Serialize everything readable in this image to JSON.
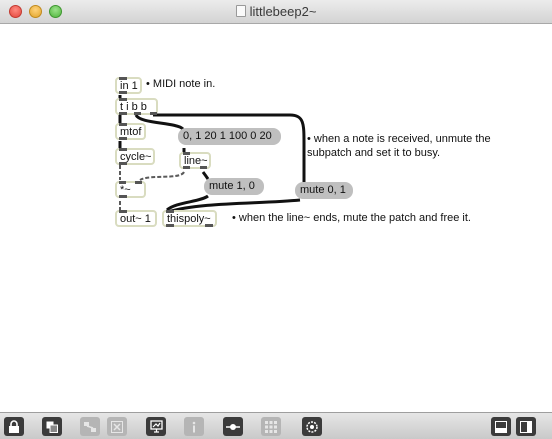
{
  "window": {
    "title": "littlebeep2~"
  },
  "patch": {
    "objects": {
      "in1": "in 1",
      "tibb": "t i b b",
      "mtof": "mtof",
      "cycle": "cycle~",
      "mult": "*~",
      "out": "out~ 1",
      "line": "line~",
      "thispoly": "thispoly~"
    },
    "messages": {
      "ramp": "0, 1 20 1 100 0 20",
      "mute1": "mute 1, 0",
      "mute0": "mute 0, 1"
    },
    "comments": {
      "midi": "• MIDI note in.",
      "received_1": "• when a note is received, unmute the",
      "received_2": "subpatch and set it to busy.",
      "line_ends": "• when the line~ ends, mute the patch and free it."
    }
  },
  "toolbar": {
    "items": [
      "lock-icon",
      "new-object-icon",
      "patch-cord-icon",
      "delete-icon",
      "presentation-icon",
      "inspector-icon",
      "connection-icon",
      "grid-icon",
      "dsp-icon",
      "split-horizontal-icon",
      "split-vertical-icon"
    ]
  },
  "colors": {
    "object_border": "#d9dcc0",
    "message_fill": "#bfbfbf",
    "patch_cord": "#111111",
    "signal_cord": "#5a5a5a"
  }
}
